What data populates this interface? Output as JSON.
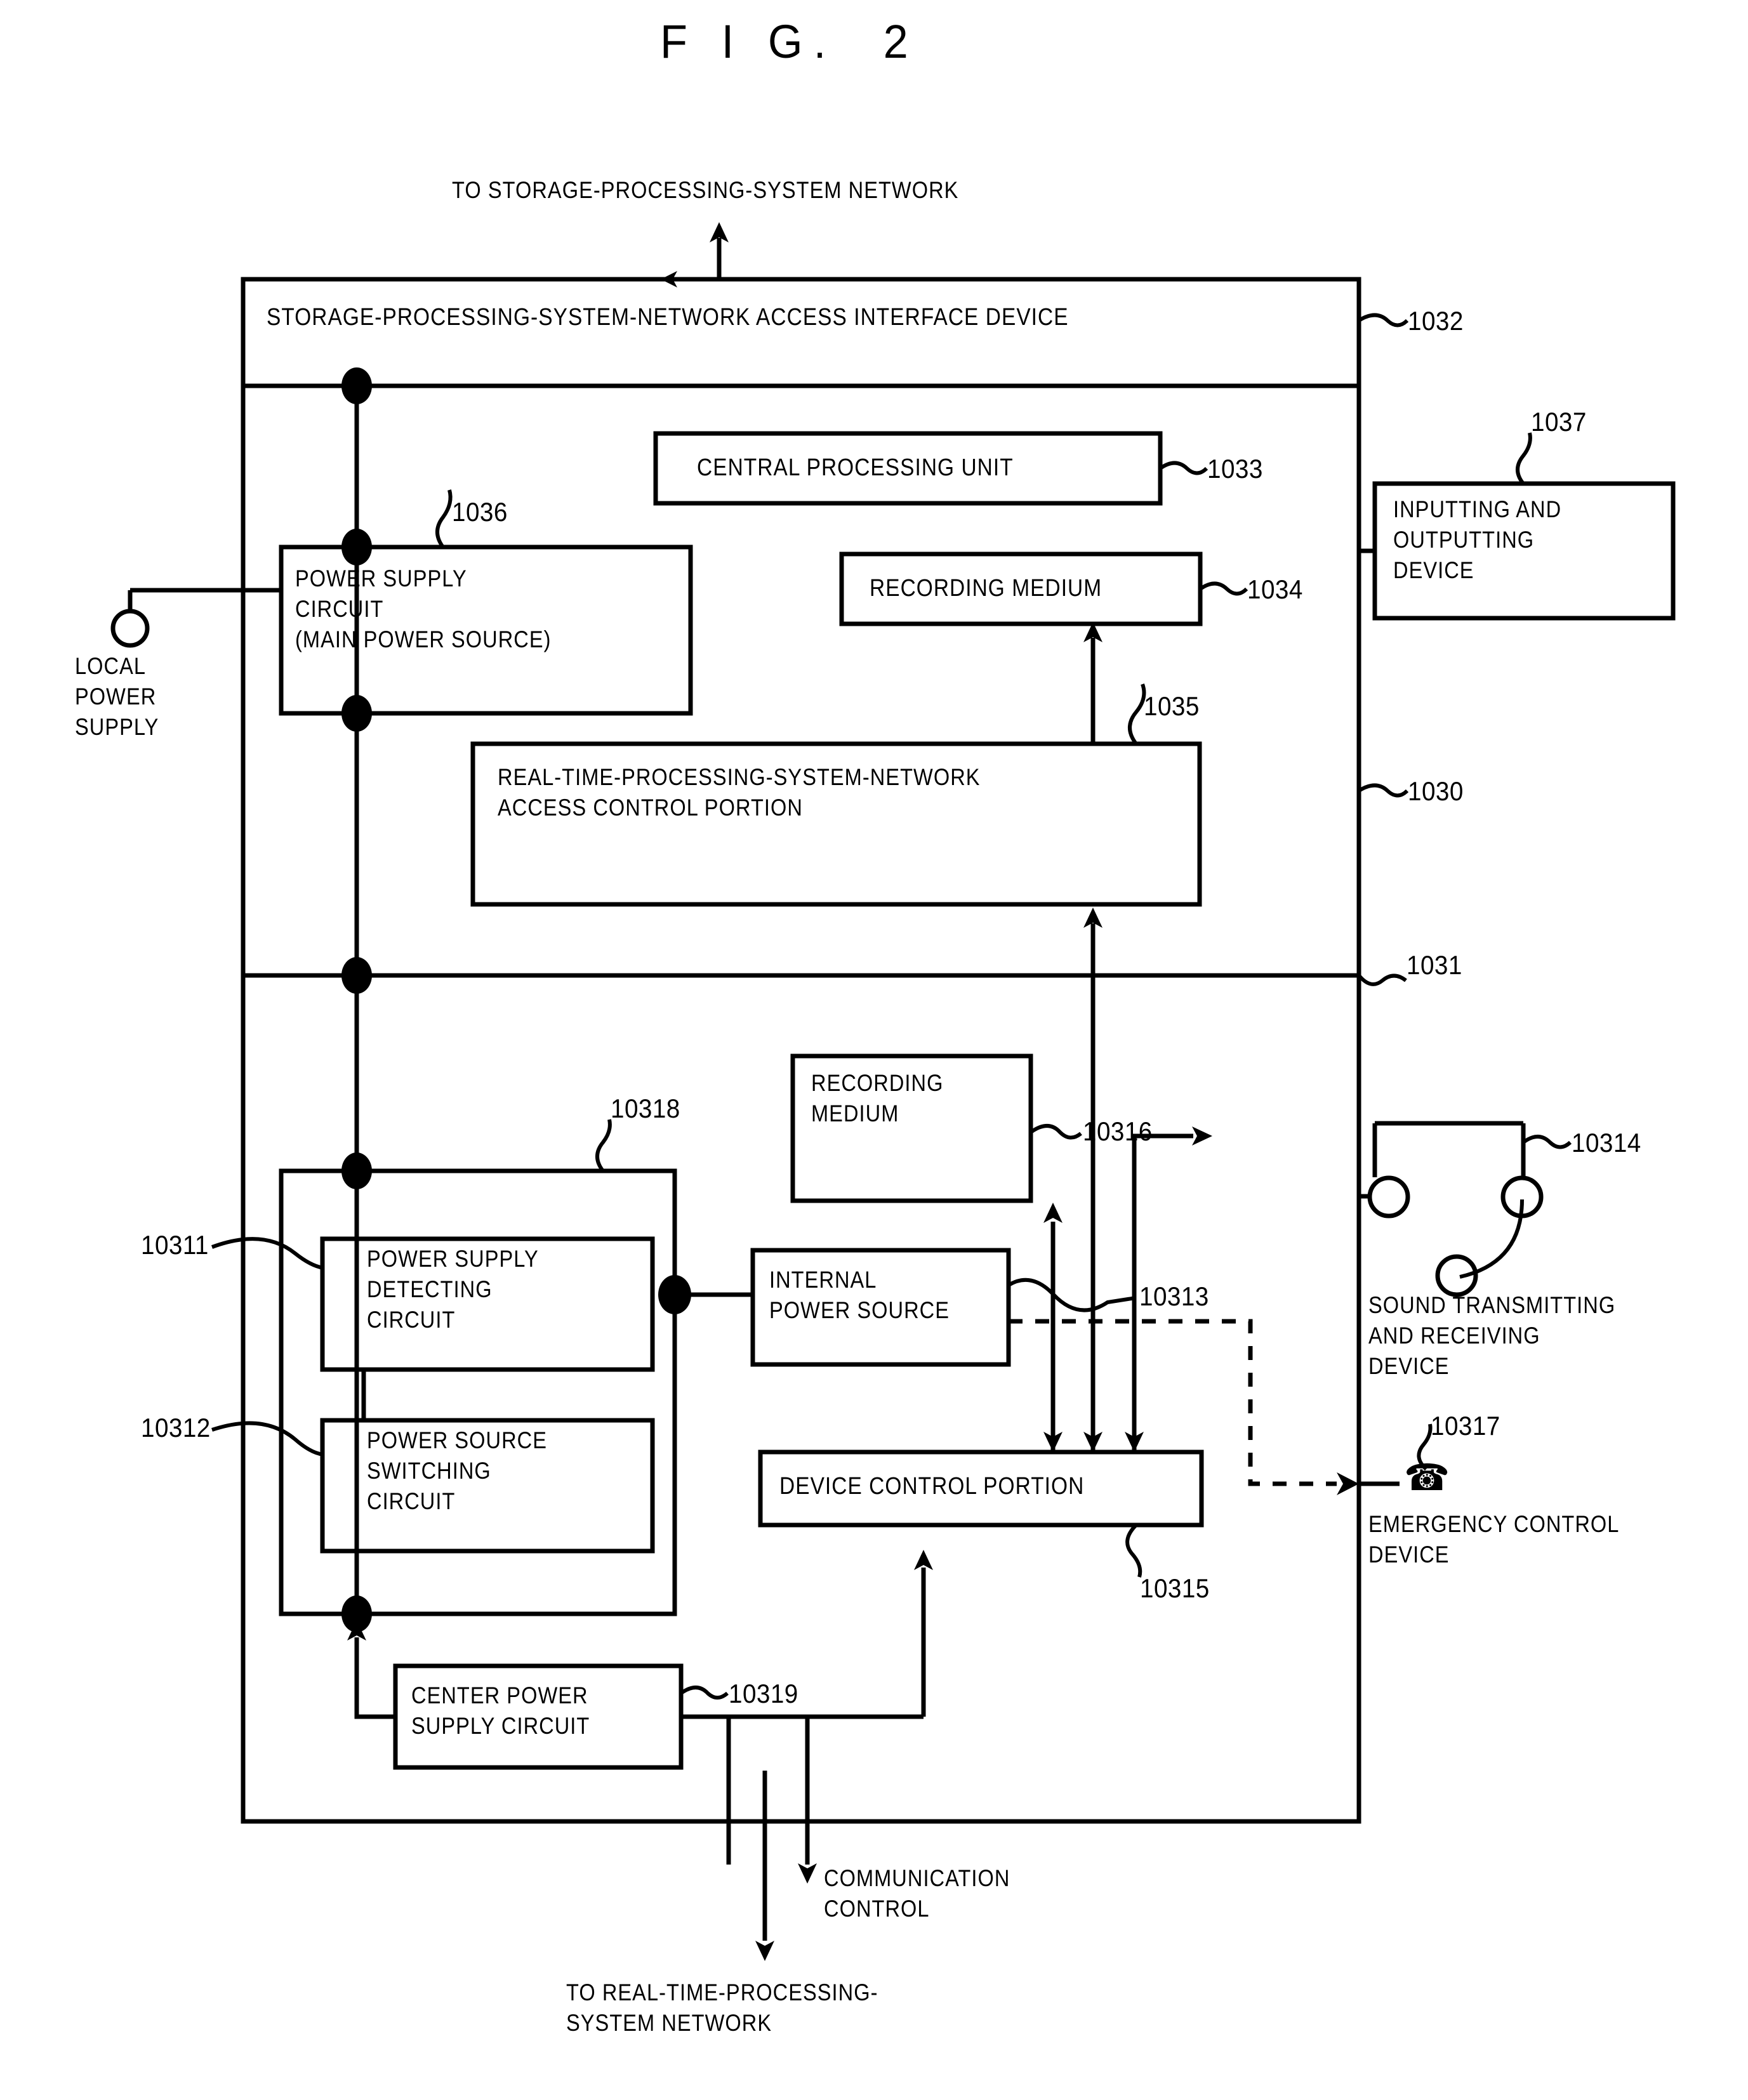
{
  "figure": {
    "title": "F I G.  2",
    "top_caption": "TO STORAGE-PROCESSING-SYSTEM NETWORK",
    "bottom_caption_line1": "TO REAL-TIME-PROCESSING-",
    "bottom_caption_line2": "SYSTEM NETWORK",
    "communication_control_line1": "COMMUNICATION",
    "communication_control_line2": "CONTROL"
  },
  "blocks": {
    "interface_device": "STORAGE-PROCESSING-SYSTEM-NETWORK ACCESS INTERFACE DEVICE",
    "cpu": "CENTRAL PROCESSING UNIT",
    "recording_medium_upper": "RECORDING MEDIUM",
    "power_supply_circuit_line1": "POWER SUPPLY",
    "power_supply_circuit_line2": "CIRCUIT",
    "power_supply_circuit_line3": "(MAIN POWER SOURCE)",
    "rt_access_control_line1": "REAL-TIME-PROCESSING-SYSTEM-NETWORK",
    "rt_access_control_line2": "ACCESS CONTROL PORTION",
    "inputting_outputting_line1": "INPUTTING AND",
    "inputting_outputting_line2": "OUTPUTTING",
    "inputting_outputting_line3": "DEVICE",
    "recording_medium_lower_line1": "RECORDING",
    "recording_medium_lower_line2": "MEDIUM",
    "power_supply_detecting_line1": "POWER SUPPLY",
    "power_supply_detecting_line2": "DETECTING",
    "power_supply_detecting_line3": "CIRCUIT",
    "power_source_switching_line1": "POWER SOURCE",
    "power_source_switching_line2": "SWITCHING",
    "power_source_switching_line3": "CIRCUIT",
    "internal_power_source_line1": "INTERNAL",
    "internal_power_source_line2": "POWER SOURCE",
    "device_control_portion": "DEVICE CONTROL PORTION",
    "center_power_supply_line1": "CENTER POWER",
    "center_power_supply_line2": "SUPPLY CIRCUIT"
  },
  "external": {
    "local_power_supply_line1": "LOCAL",
    "local_power_supply_line2": "POWER",
    "local_power_supply_line3": "SUPPLY",
    "sound_device_line1": "SOUND TRANSMITTING",
    "sound_device_line2": "AND RECEIVING",
    "sound_device_line3": "DEVICE",
    "emergency_device_line1": "EMERGENCY CONTROL",
    "emergency_device_line2": "DEVICE",
    "phone_glyph": "☎"
  },
  "reference_numerals": {
    "n1030": "1030",
    "n1031": "1031",
    "n1032": "1032",
    "n1033": "1033",
    "n1034": "1034",
    "n1035": "1035",
    "n1036": "1036",
    "n1037": "1037",
    "n10311": "10311",
    "n10312": "10312",
    "n10313": "10313",
    "n10314": "10314",
    "n10315": "10315",
    "n10316": "10316",
    "n10317": "10317",
    "n10318": "10318",
    "n10319": "10319"
  },
  "colors": {
    "ink": "#000000",
    "paper": "#ffffff"
  }
}
